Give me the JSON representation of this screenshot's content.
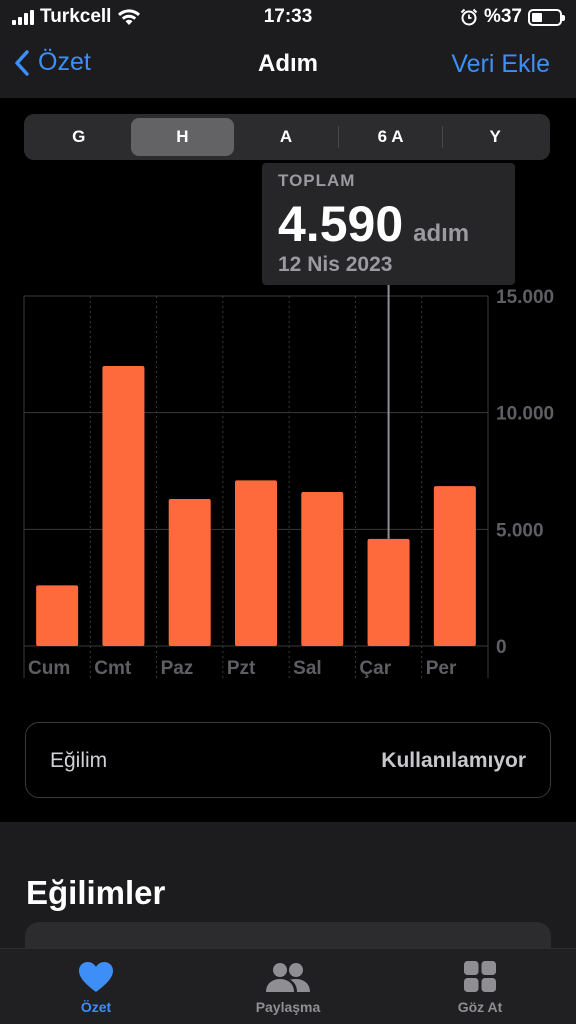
{
  "status": {
    "carrier": "Turkcell",
    "time": "17:33",
    "battery": "%37",
    "battery_level": 0.37
  },
  "nav": {
    "back_label": "Özet",
    "title": "Adım",
    "action_label": "Veri Ekle"
  },
  "segments": [
    "G",
    "H",
    "A",
    "6 A",
    "Y"
  ],
  "active_segment": "H",
  "tooltip": {
    "label": "TOPLAM",
    "value": "4.590",
    "unit": "adım",
    "date": "12 Nis 2023"
  },
  "chart_data": {
    "type": "bar",
    "categories": [
      "Cum",
      "Cmt",
      "Paz",
      "Pzt",
      "Sal",
      "Çar",
      "Per"
    ],
    "values": [
      2600,
      12000,
      6300,
      7100,
      6600,
      4590,
      6850
    ],
    "ylim": [
      0,
      15000
    ],
    "yticks": [
      0,
      5000,
      10000,
      15000
    ],
    "ytick_labels": [
      "0",
      "5.000",
      "10.000",
      "15.000"
    ],
    "selected_index": 5,
    "bar_color": "#ff6a3c",
    "grid": true
  },
  "trend": {
    "label": "Eğilim",
    "value": "Kullanılamıyor"
  },
  "section": {
    "title": "Eğilimler"
  },
  "tabs": [
    {
      "label": "Özet",
      "icon": "heart-icon",
      "active": true
    },
    {
      "label": "Paylaşma",
      "icon": "people-icon",
      "active": false
    },
    {
      "label": "Göz At",
      "icon": "grid-icon",
      "active": false
    }
  ],
  "colors": {
    "accent": "#3d8ef7",
    "bar": "#ff6a3c"
  }
}
